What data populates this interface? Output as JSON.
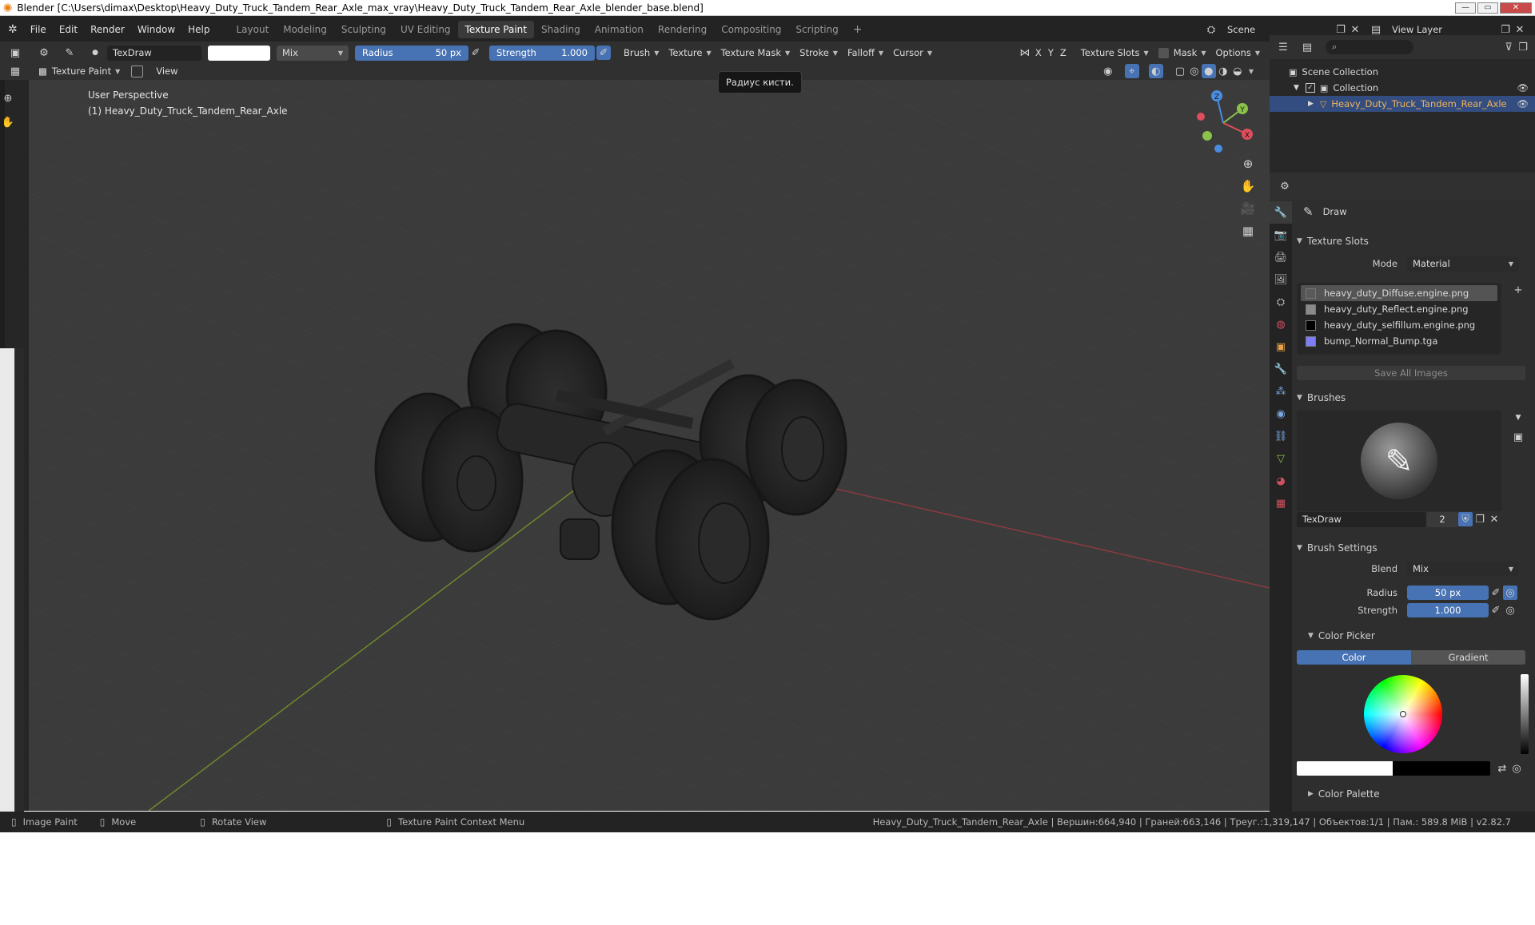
{
  "window": {
    "title": "Blender [C:\\Users\\dimax\\Desktop\\Heavy_Duty_Truck_Tandem_Rear_Axle_max_vray\\Heavy_Duty_Truck_Tandem_Rear_Axle_blender_base.blend]",
    "minimize": "—",
    "maximize": "▭",
    "close": "✕"
  },
  "menu": [
    "File",
    "Edit",
    "Render",
    "Window",
    "Help"
  ],
  "workspaces": [
    {
      "label": "Layout",
      "active": false
    },
    {
      "label": "Modeling",
      "active": false
    },
    {
      "label": "Sculpting",
      "active": false
    },
    {
      "label": "UV Editing",
      "active": false
    },
    {
      "label": "Texture Paint",
      "active": true
    },
    {
      "label": "Shading",
      "active": false
    },
    {
      "label": "Animation",
      "active": false
    },
    {
      "label": "Rendering",
      "active": false
    },
    {
      "label": "Compositing",
      "active": false
    },
    {
      "label": "Scripting",
      "active": false
    }
  ],
  "add_workspace": "+",
  "scene": {
    "name": "Scene",
    "view_layer": "View Layer"
  },
  "tool_header": {
    "brush_name": "TexDraw",
    "blend": "Mix",
    "radius_label": "Radius",
    "radius_value": "50 px",
    "strength_label": "Strength",
    "strength_value": "1.000",
    "menus": [
      "Brush",
      "Texture",
      "Texture Mask",
      "Stroke",
      "Falloff",
      "Cursor"
    ],
    "axes": [
      "X",
      "Y",
      "Z"
    ],
    "texture_slots": "Texture Slots",
    "mask": "Mask",
    "options": "Options"
  },
  "mode_header": {
    "mode": "Texture Paint",
    "view": "View"
  },
  "tooltip": "Радиус кисти.",
  "viewport": {
    "perspective": "User Perspective",
    "object": "(1) Heavy_Duty_Truck_Tandem_Rear_Axle"
  },
  "gizmo": {
    "x": "X",
    "y": "Y",
    "z": "Z"
  },
  "outliner": {
    "search_placeholder": "",
    "scene_collection": "Scene Collection",
    "collection": "Collection",
    "object": "Heavy_Duty_Truck_Tandem_Rear_Axle"
  },
  "properties": {
    "tool_name": "Draw",
    "texture_slots": {
      "title": "Texture Slots",
      "mode_label": "Mode",
      "mode_value": "Material",
      "slots": [
        {
          "name": "heavy_duty_Diffuse.engine.png",
          "color": "#5a5a5a",
          "selected": true
        },
        {
          "name": "heavy_duty_Reflect.engine.png",
          "color": "#8a8a8a",
          "selected": false
        },
        {
          "name": "heavy_duty_selfillum.engine.png",
          "color": "#000000",
          "selected": false
        },
        {
          "name": "bump_Normal_Bump.tga",
          "color": "#7d7df5",
          "selected": false
        }
      ],
      "save_all": "Save All Images"
    },
    "brushes": {
      "title": "Brushes",
      "brush_name": "TexDraw",
      "users": "2"
    },
    "brush_settings": {
      "title": "Brush Settings",
      "blend_label": "Blend",
      "blend_value": "Mix",
      "radius_label": "Radius",
      "radius_value": "50 px",
      "strength_label": "Strength",
      "strength_value": "1.000"
    },
    "color_picker": {
      "title": "Color Picker",
      "tab_color": "Color",
      "tab_gradient": "Gradient",
      "active_tab": "Color"
    },
    "color_palette": {
      "title": "Color Palette"
    }
  },
  "statusbar": {
    "items": [
      "Image Paint",
      "Move",
      "Rotate View",
      "Texture Paint Context Menu"
    ],
    "stats": "Heavy_Duty_Truck_Tandem_Rear_Axle | Вершин:664,940 | Граней:663,146 | Треуг.:1,319,147 | Объектов:1/1 | Пам.: 589.8 MiB | v2.82.7"
  },
  "colors": {
    "accent": "#4772b3",
    "x_axis": "#e04d5c",
    "y_axis": "#8bc34a",
    "z_axis": "#4a8ce0",
    "viewport_bg": "#3b3b3b"
  }
}
